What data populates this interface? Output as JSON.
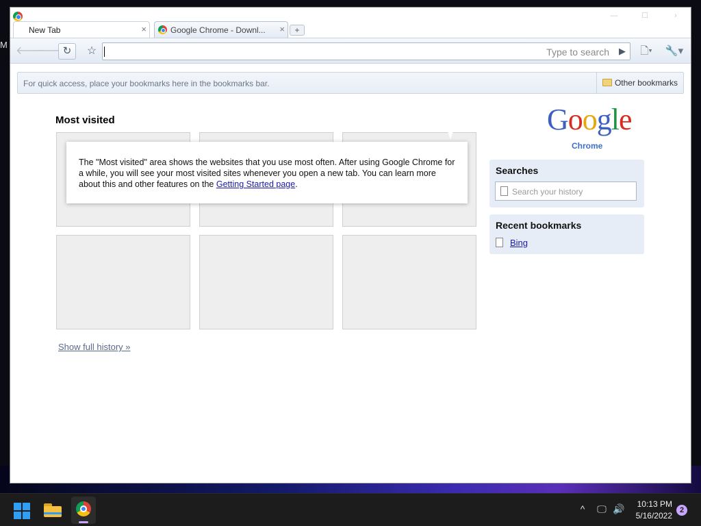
{
  "desktop": {
    "edge_text": "M"
  },
  "window": {
    "tabs": [
      {
        "title": "New Tab",
        "active": true
      },
      {
        "title": "Google Chrome - Downl...",
        "active": false
      }
    ],
    "controls": {
      "minimize": "—",
      "maximize": "☐",
      "close": "›"
    },
    "new_tab_glyph": "+"
  },
  "toolbar": {
    "back_icon": "back-arrow-icon",
    "forward_icon": "forward-arrow-icon",
    "reload_glyph": "↻",
    "star_glyph": "☆",
    "omnibox_value": "",
    "omnibox_hint": "Type to search",
    "go_glyph": "▶",
    "page_menu_glyph": "🗋▾",
    "wrench_glyph": "🔧▾"
  },
  "bookmarks_bar": {
    "hint": "For quick access, place your bookmarks here in the bookmarks bar.",
    "other_bookmarks": "Other bookmarks"
  },
  "new_tab_page": {
    "most_visited_title": "Most visited",
    "tooltip": {
      "text_before": "The \"Most visited\" area shows the websites that you use most often. After using Google Chrome for a while, you will see your most visited sites whenever you open a new tab. You can learn more about this and other features on the ",
      "link": "Getting Started page",
      "text_after": "."
    },
    "show_full_history": "Show full history »",
    "logo": {
      "word": "Google",
      "sub": "Chrome"
    },
    "searches": {
      "title": "Searches",
      "placeholder": "Search your history"
    },
    "recent_bookmarks": {
      "title": "Recent bookmarks",
      "items": [
        "Bing"
      ]
    }
  },
  "taskbar": {
    "tray": {
      "chevron": "^",
      "network_glyph": "🖵",
      "volume_glyph": "🔊"
    },
    "time": "10:13 PM",
    "date": "5/16/2022",
    "notification_count": "2"
  },
  "colors": {
    "link": "#1a1aa6",
    "side_box_bg": "#e6edf7",
    "thumb_bg": "#eeeeee",
    "taskbar_bg": "#1c1c1c",
    "accent": "#c8a6ff"
  }
}
